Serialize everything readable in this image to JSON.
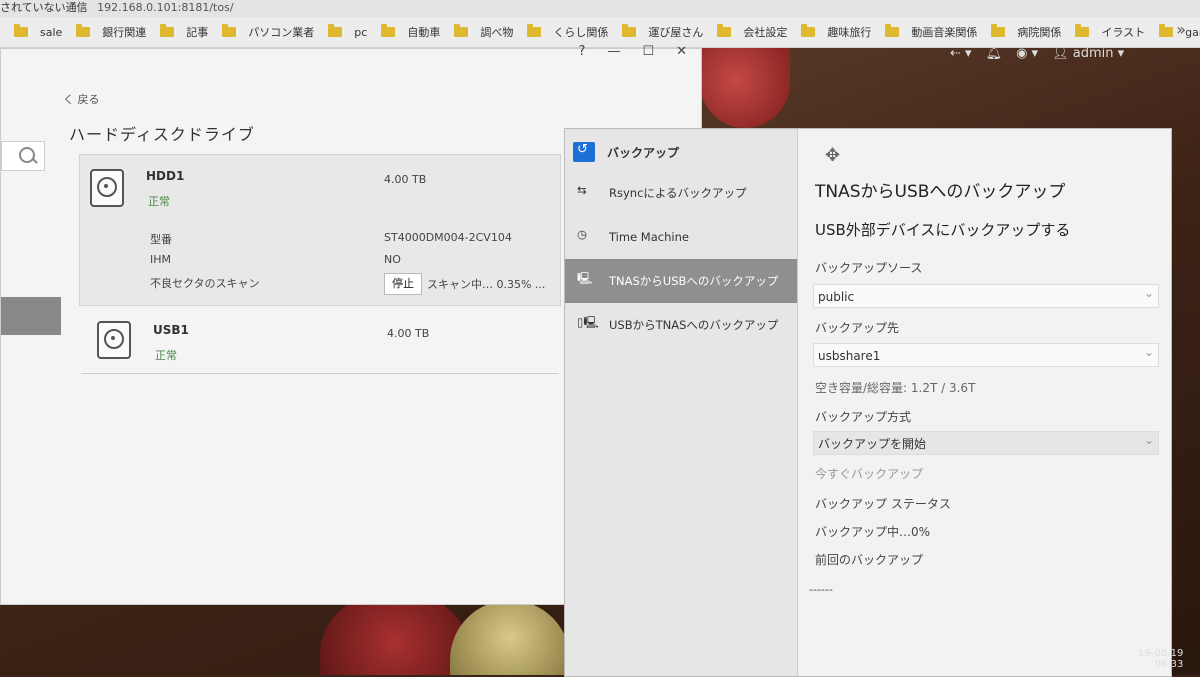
{
  "browser": {
    "security_label": "されていない通信",
    "url": "192.168.0.101:8181/tos/",
    "bookmarks": [
      "sale",
      "銀行関連",
      "記事",
      "パソコン業者",
      "pc",
      "自動車",
      "調べ物",
      "くらし関係",
      "運び屋さん",
      "会社設定",
      "趣味旅行",
      "動画音楽関係",
      "病院関係",
      "イラスト",
      "game"
    ],
    "more": "»"
  },
  "topnav": {
    "user": "admin"
  },
  "storage": {
    "window_controls": [
      "?",
      "—",
      "☐",
      "✕"
    ],
    "back": "く 戻る",
    "title": "ハードディスクドライブ",
    "hdd1": {
      "name": "HDD1",
      "status": "正常",
      "capacity": "4.00 TB",
      "model_label": "型番",
      "model_value": "ST4000DM004-2CV104",
      "ihm_label": "IHM",
      "ihm_value": "NO",
      "scan_label": "不良セクタのスキャン",
      "stop_button": "停止",
      "scan_status": "スキャン中… 0.35% ..."
    },
    "usb1": {
      "name": "USB1",
      "status": "正常",
      "capacity": "4.00 TB"
    }
  },
  "backup": {
    "app_title": "バックアップ",
    "menu": [
      {
        "label": "Rsyncによるバックアップ",
        "icon": "rsync-icon"
      },
      {
        "label": "Time Machine",
        "icon": "time-machine-icon"
      },
      {
        "label": "TNASからUSBへのバックアップ",
        "icon": "nas-to-usb-icon"
      },
      {
        "label": "USBからTNASへのバックアップ",
        "icon": "usb-to-nas-icon"
      }
    ],
    "title": "TNASからUSBへのバックアップ",
    "subtitle": "USB外部デバイスにバックアップする",
    "source_label": "バックアップソース",
    "source_value": "public",
    "dest_label": "バックアップ先",
    "dest_value": "usbshare1",
    "capacity": "空き容量/総容量: 1.2T / 3.6T",
    "method_label": "バックアップ方式",
    "method_value": "バックアップを開始",
    "now_label": "今すぐバックアップ",
    "status_label": "バックアップ ステータス",
    "progress": "バックアップ中…0%",
    "last_label": "前回のバックアップ",
    "last_value": "------"
  },
  "clock": {
    "date": "19-08-19",
    "time": "06:33"
  }
}
